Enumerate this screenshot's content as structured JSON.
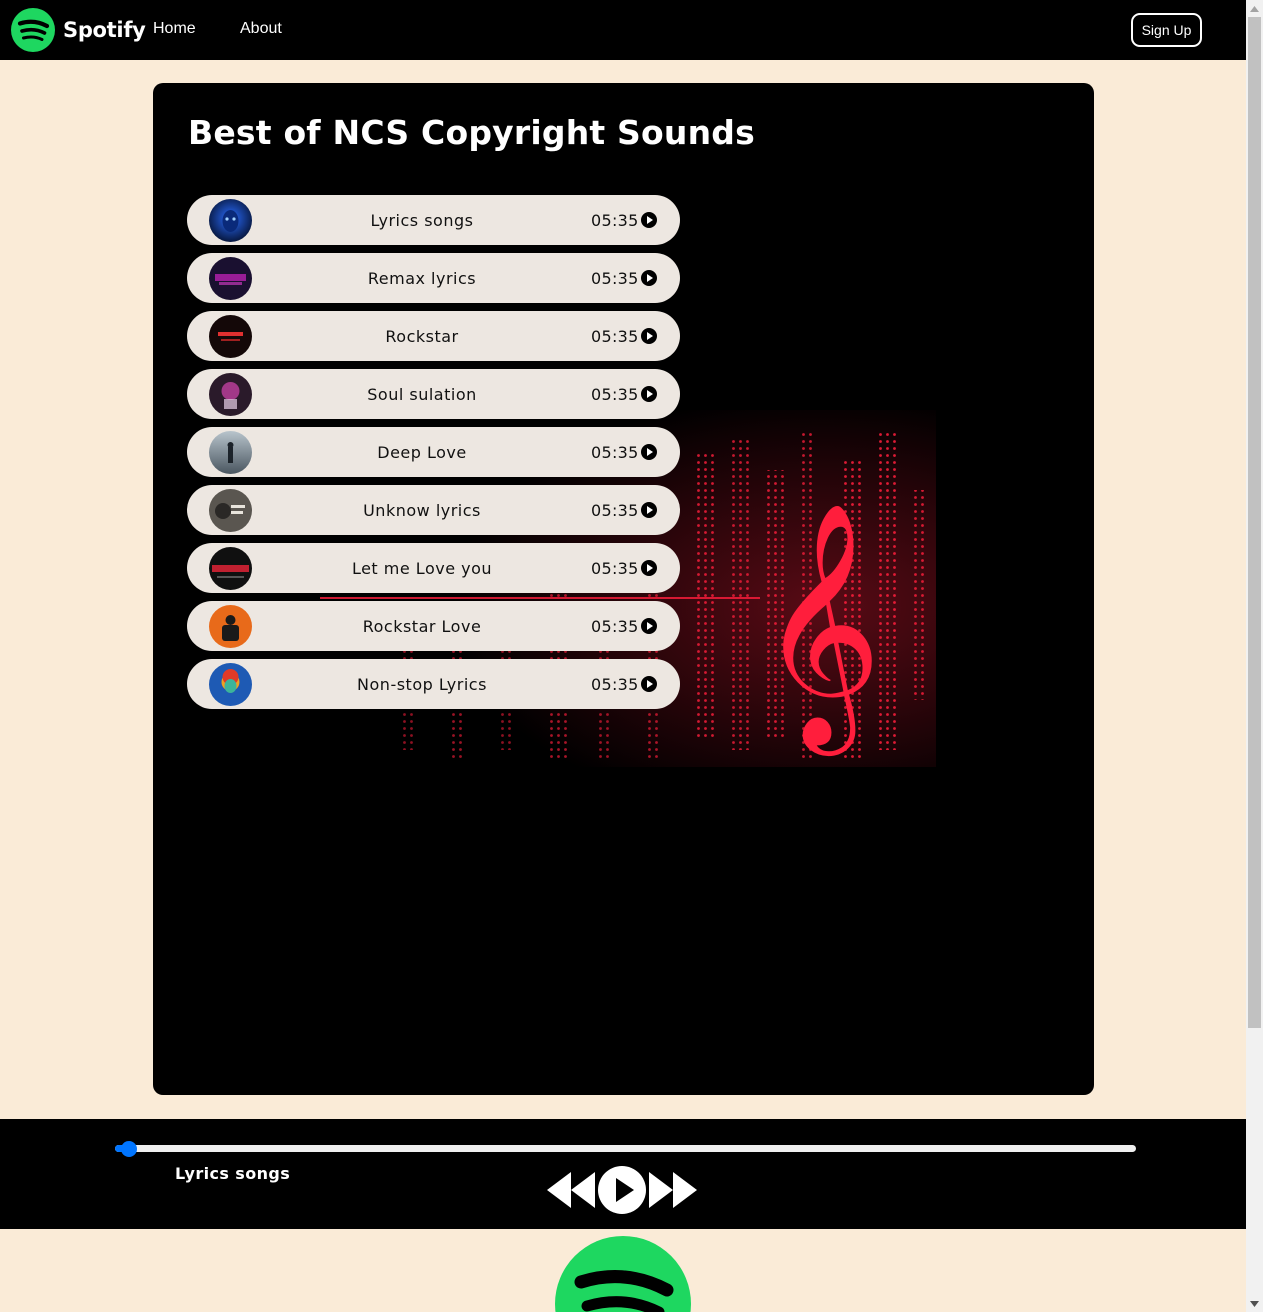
{
  "navbar": {
    "brand": "Spotify",
    "brand_icon": "spotify-logo-icon",
    "links": [
      "Home",
      "About"
    ],
    "signup_label": "Sign Up"
  },
  "playlist": {
    "title": "Best of NCS Copyright Sounds",
    "background_icon": "treble-clef-equalizer-art",
    "songs": [
      {
        "name": "Lyrics songs",
        "duration": "05:35",
        "cover_icon": "album-cover-blue-face"
      },
      {
        "name": "Remax lyrics",
        "duration": "05:35",
        "cover_icon": "album-cover-neon-purple"
      },
      {
        "name": "Rockstar",
        "duration": "05:35",
        "cover_icon": "album-cover-dark-red-text"
      },
      {
        "name": "Soul sulation",
        "duration": "05:35",
        "cover_icon": "album-cover-pink-astronaut"
      },
      {
        "name": "Deep Love",
        "duration": "05:35",
        "cover_icon": "album-cover-misty-figure"
      },
      {
        "name": "Unknow lyrics",
        "duration": "05:35",
        "cover_icon": "album-cover-grey-text"
      },
      {
        "name": "Let me Love you",
        "duration": "05:35",
        "cover_icon": "album-cover-back-it-up"
      },
      {
        "name": "Rockstar Love",
        "duration": "05:35",
        "cover_icon": "album-cover-orange-figure"
      },
      {
        "name": "Non-stop Lyrics",
        "duration": "05:35",
        "cover_icon": "album-cover-colorful-portrait"
      }
    ]
  },
  "player": {
    "now_playing": "Lyrics songs",
    "progress_percent": 1,
    "controls": [
      "previous-icon",
      "play-icon",
      "next-icon"
    ]
  },
  "colors": {
    "page_bg": "#faebd7",
    "card_bg": "#000000",
    "song_item_bg": "#ede7e1",
    "brand_green": "#1ed760",
    "progress_blue": "#0075ff"
  }
}
